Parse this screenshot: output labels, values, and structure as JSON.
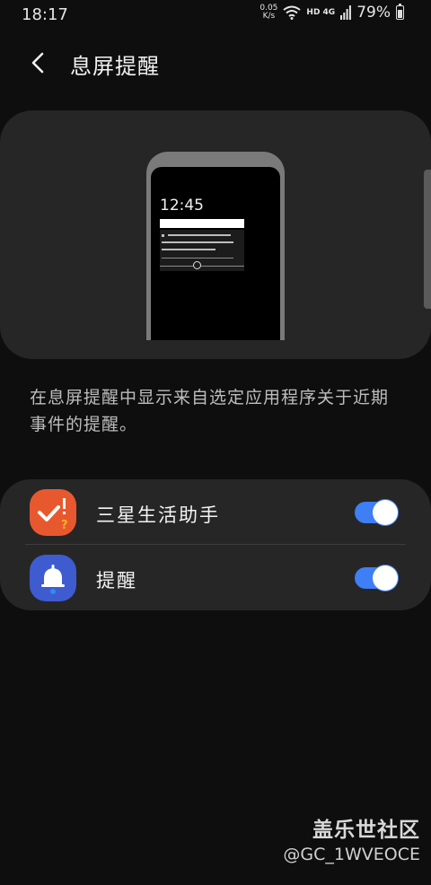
{
  "status": {
    "time": "18:17",
    "net_speed_value": "0.05",
    "net_speed_unit": "K/s",
    "network_type": "HD 4G",
    "battery": "79%",
    "battery_level": 0.79
  },
  "header": {
    "title": "息屏提醒"
  },
  "preview": {
    "clock": "12:45"
  },
  "description": "在息屏提醒中显示来自选定应用程序关于近期事件的提醒。",
  "apps": [
    {
      "label": "三星生活助手",
      "icon": "samsung-life-assistant-icon",
      "enabled": true,
      "color": "#e8582f"
    },
    {
      "label": "提醒",
      "icon": "bell-icon",
      "enabled": true,
      "color": "#3f5bd0"
    }
  ],
  "toggle_color": "#3e7ff5",
  "watermark": {
    "title": "盖乐世社区",
    "id": "@GC_1WVEOCE"
  }
}
